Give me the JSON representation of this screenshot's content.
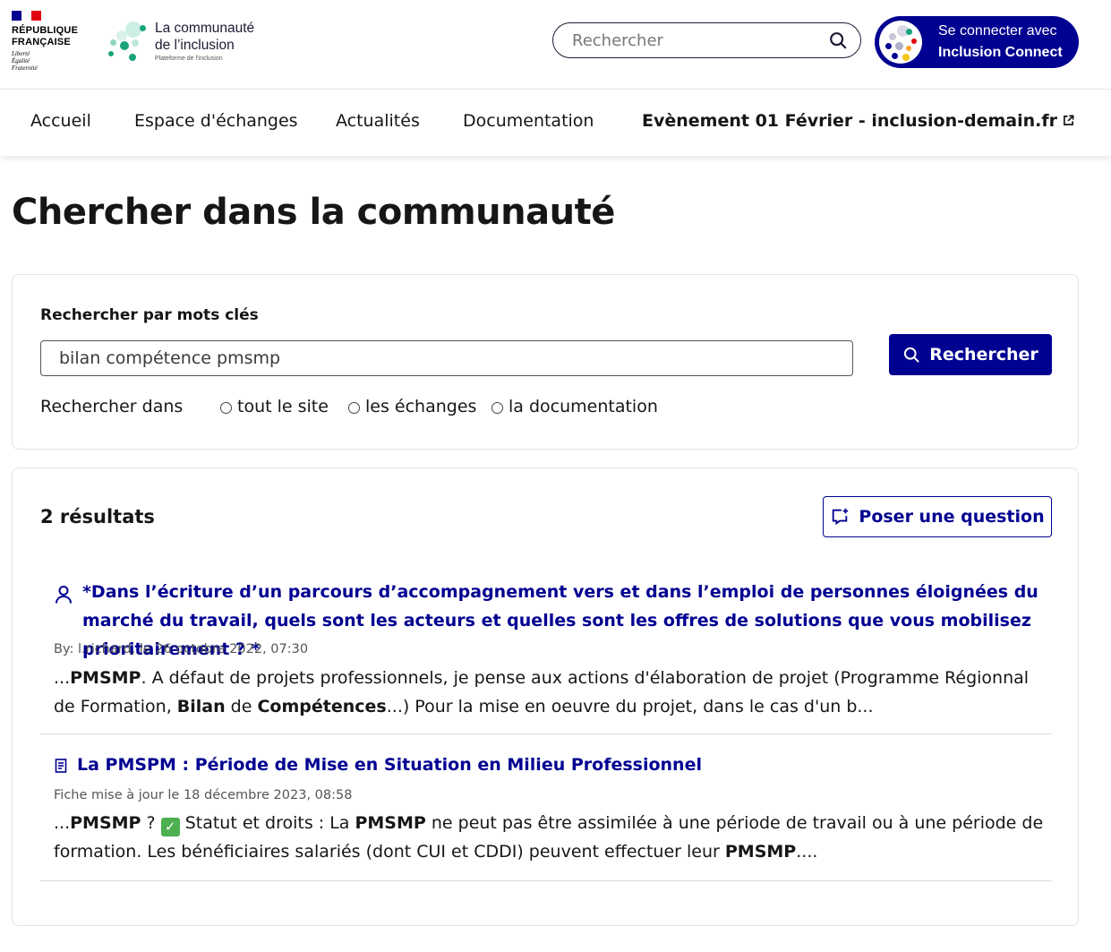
{
  "header": {
    "gov": {
      "line1": "RÉPUBLIQUE",
      "line2": "FRANÇAISE",
      "motto": [
        "Liberté",
        "Égalité",
        "Fraternité"
      ],
      "flag_colors": [
        "#000091",
        "#ffffff",
        "#e1000f"
      ]
    },
    "brand": {
      "title_line1": "La communauté",
      "title_line2": "de l’inclusion",
      "subtitle": "Plateforme de l'inclusion"
    },
    "search": {
      "placeholder": "Rechercher",
      "icon": "search-icon"
    },
    "connect": {
      "line1": "Se connecter avec",
      "line2": "Inclusion Connect"
    }
  },
  "nav": {
    "items": [
      {
        "label": "Accueil"
      },
      {
        "label": "Espace d'échanges"
      },
      {
        "label": "Actualités"
      },
      {
        "label": "Documentation"
      },
      {
        "label": "Evènement 01 Février - inclusion-demain.fr",
        "icon": "external-link-icon"
      }
    ]
  },
  "page": {
    "title": "Chercher dans la communauté"
  },
  "search_form": {
    "label": "Rechercher par mots clés",
    "value": "bilan compétence pmsmp",
    "button": "Rechercher",
    "scope_label": "Rechercher dans",
    "scopes": [
      {
        "label": "tout le site",
        "checked": false
      },
      {
        "label": "les échanges",
        "checked": false
      },
      {
        "label": "la documentation",
        "checked": false
      }
    ]
  },
  "results": {
    "count_label": "2 résultats",
    "ask_button": "Poser une question",
    "items": [
      {
        "icon": "user-icon",
        "title": "*Dans l’écriture d’un parcours d’accompagnement vers et dans l’emploi de personnes éloignées du marché du travail, quels sont les acteurs et quelles sont les offres de solutions que vous mobilisez prioritairement ? *",
        "meta": "By: l.richard, le 26 octobre 2022, 07:30",
        "excerpt_html": "...<b>PMSMP</b>. A défaut de projets professionnels, je pense aux actions d'élaboration de projet (Programme Régionnal de Formation, <b>Bilan</b> de <b>Compétences</b>...) Pour la mise en oeuvre du projet, dans le cas d'un b..."
      },
      {
        "icon": "document-icon",
        "title": "La PMSPM : Période de Mise en Situation en Milieu Professionnel",
        "meta": "Fiche mise à jour le 18 décembre 2023, 08:58",
        "excerpt_html": "...<b>PMSMP</b> ? <span class=\"check\" data-name=\"check-emoji-icon\" data-interactable=\"false\">✓</span> Statut et droits : La <b>PMSMP</b> ne peut pas être assimilée à une période de travail ou à une période de formation. Les bénéficiaires salariés (dont CUI et CDDI) peuvent effectuer leur <b>PMSMP</b>...."
      }
    ]
  },
  "colors": {
    "primary": "#000091",
    "text": "#161616",
    "brand_green": "#1aa37a",
    "brand_teal_light": "#bfe8dc"
  }
}
